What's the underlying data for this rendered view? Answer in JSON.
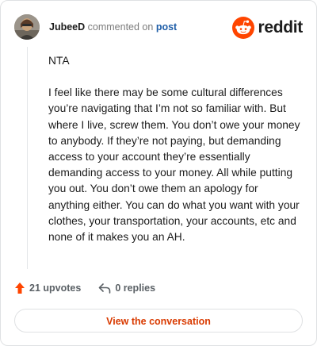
{
  "header": {
    "username": "JubeeD",
    "commented_on": "commented on",
    "post_link": "post",
    "brand": "reddit"
  },
  "comment": {
    "paragraphs": [
      "NTA",
      "I feel like there may be some cultural differences you’re navigating that I’m not so familiar with. But where I live, screw them. You don’t owe your money to anybody. If they’re not paying, but demanding access to your account they’re essentially demanding access to your money. All while putting you out. You don’t owe them an apology for anything either. You can do what you want with your clothes, your transportation, your accounts, etc and none of it makes you an AH."
    ]
  },
  "actions": {
    "upvotes": "21 upvotes",
    "replies": "0 replies"
  },
  "view_button": "View the conversation",
  "colors": {
    "reddit_orange": "#ff4500",
    "link_blue": "#1f5ea8",
    "button_text": "#d93a00",
    "upvote_arrow": "#ff4500"
  },
  "icons": {
    "avatar": "avatar",
    "logo": "reddit-snoo-icon",
    "upvote": "upvote-arrow-icon",
    "reply": "reply-arrow-icon"
  }
}
